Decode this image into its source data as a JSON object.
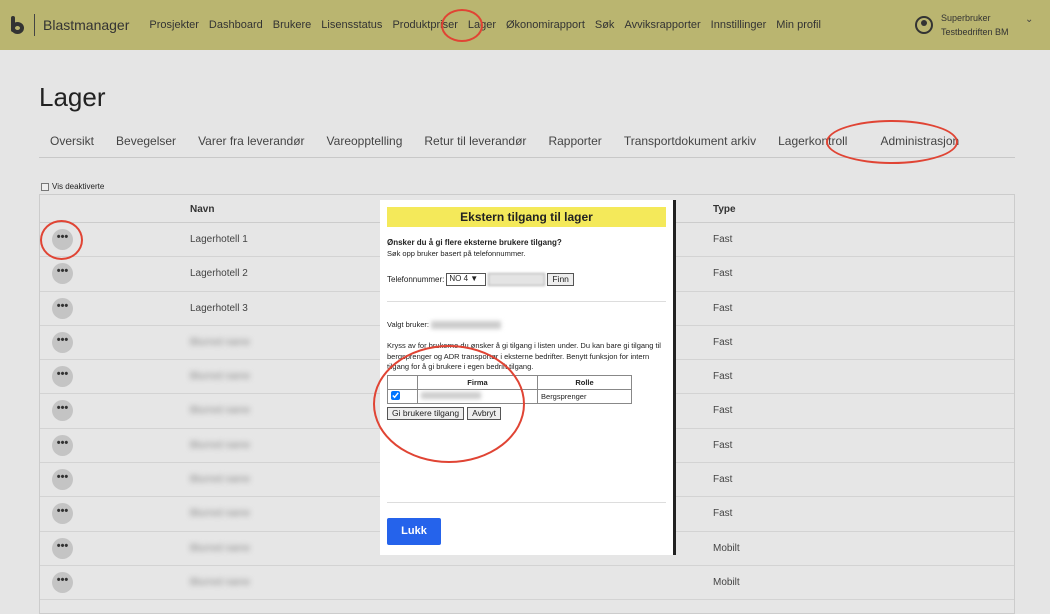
{
  "header": {
    "brand": "Blastmanager",
    "nav": [
      "Prosjekter",
      "Dashboard",
      "Brukere",
      "Lisensstatus",
      "Produktpriser",
      "Lager",
      "Økonomirapport",
      "Søk",
      "Avviksrapporter",
      "Innstillinger",
      "Min profil"
    ],
    "user_role": "Superbruker",
    "user_company": "Testbedriften BM"
  },
  "page": {
    "title": "Lager",
    "tabs": [
      "Oversikt",
      "Bevegelser",
      "Varer fra leverandør",
      "Vareopptelling",
      "Retur til leverandør",
      "Rapporter",
      "Transportdokument arkiv",
      "Lagerkontroll",
      "Administrasjon"
    ],
    "active_tab": "Administrasjon",
    "show_deactivated": "Vis deaktiverte"
  },
  "table": {
    "headers": {
      "name": "Navn",
      "type": "Type"
    },
    "rows": [
      {
        "name": "Lagerhotell 1",
        "type": "Fast"
      },
      {
        "name": "Lagerhotell 2",
        "type": "Fast"
      },
      {
        "name": "Lagerhotell 3",
        "type": "Fast"
      },
      {
        "name": "",
        "type": "Fast"
      },
      {
        "name": "",
        "type": "Fast"
      },
      {
        "name": "",
        "type": "Fast"
      },
      {
        "name": "",
        "type": "Fast"
      },
      {
        "name": "",
        "type": "Fast"
      },
      {
        "name": "",
        "type": "Fast"
      },
      {
        "name": "",
        "type": "Mobilt"
      },
      {
        "name": "",
        "type": "Mobilt"
      }
    ]
  },
  "modal": {
    "title": "Ekstern tilgang til lager",
    "question": "Ønsker du å gi flere eksterne brukere tilgang?",
    "sub": "Søk opp bruker basert på telefonnummer.",
    "phone_label": "Telefonnummer:",
    "country": "NO 4",
    "find": "Finn",
    "selected_label": "Valgt bruker:",
    "info": "Kryss av for brukerne du ønsker å gi tilgang i listen under. Du kan bare gi tilgang til bergsprenger og ADR transportør i eksterne bedrifter. Benytt funksjon for intern tilgang for å gi brukere i egen bedrift tilgang.",
    "col_firma": "Firma",
    "col_rolle": "Rolle",
    "row_role": "Bergsprenger",
    "row_checked": true,
    "grant": "Gi brukere tilgang",
    "cancel": "Avbryt",
    "close": "Lukk"
  },
  "colors": {
    "header": "#bab570",
    "modal_title": "#f4e95a",
    "primary": "#2563eb",
    "annotation": "#e04434"
  }
}
